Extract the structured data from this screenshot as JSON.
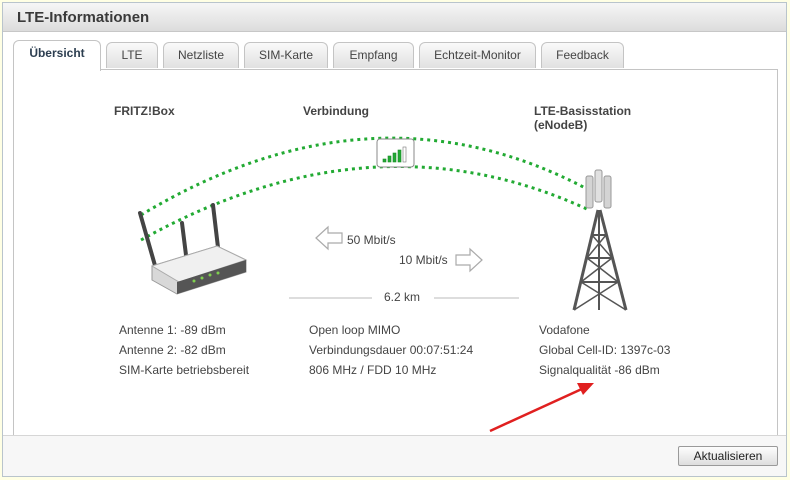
{
  "window": {
    "title": "LTE-Informationen"
  },
  "tabs": [
    {
      "label": "Übersicht",
      "active": true
    },
    {
      "label": "LTE"
    },
    {
      "label": "Netzliste"
    },
    {
      "label": "SIM-Karte"
    },
    {
      "label": "Empfang"
    },
    {
      "label": "Echtzeit-Monitor"
    },
    {
      "label": "Feedback"
    }
  ],
  "overview": {
    "device": {
      "heading": "FRITZ!Box",
      "lines": [
        "Antenne 1: -89 dBm",
        "Antenne 2: -82 dBm",
        "SIM-Karte betriebsbereit"
      ]
    },
    "connection": {
      "heading": "Verbindung",
      "downlink": "50 Mbit/s",
      "uplink": "10 Mbit/s",
      "distance": "6.2 km",
      "signal_bars": 4,
      "signal_bars_total": 5,
      "lines": [
        "Open loop MIMO",
        "Verbindungsdauer 00:07:51:24",
        "806 MHz / FDD 10 MHz"
      ]
    },
    "station": {
      "heading": "LTE-Basisstation\n(eNodeB)",
      "lines": [
        "Vodafone",
        "Global Cell-ID: 1397c-03",
        "Signalqualität -86 dBm"
      ]
    }
  },
  "footer": {
    "refresh_label": "Aktualisieren"
  },
  "colors": {
    "arc": "#22aa33",
    "annotation_arrow": "#e02020",
    "background": "#ffffe4"
  }
}
